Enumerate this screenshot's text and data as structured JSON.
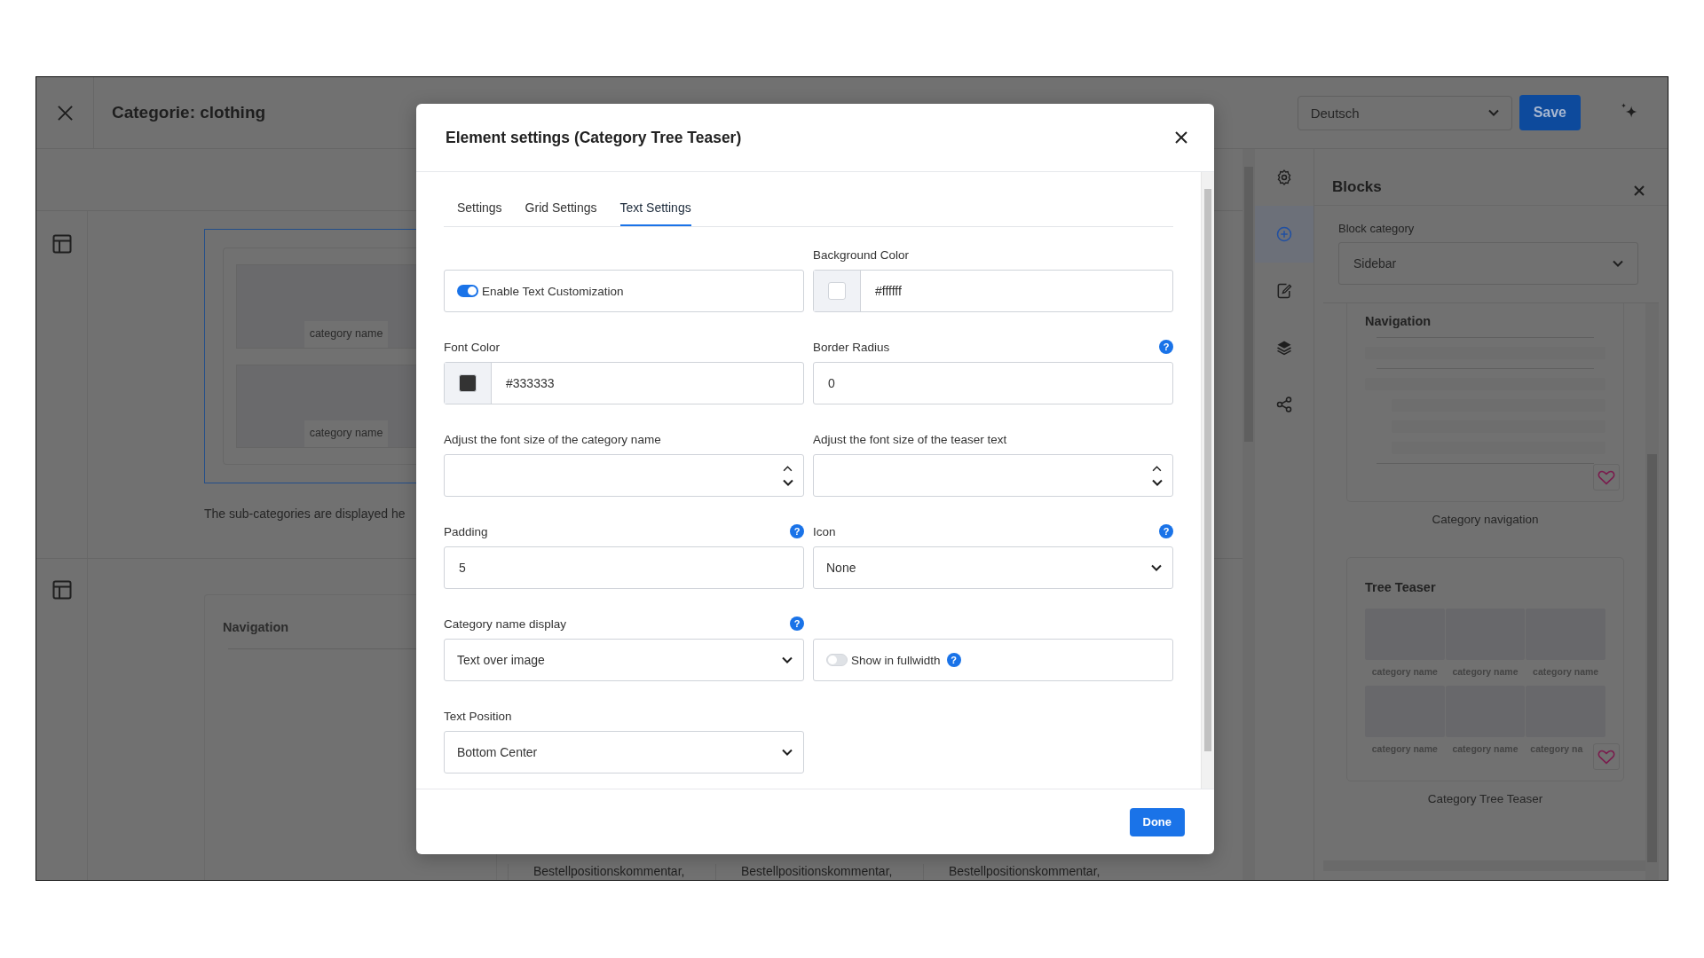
{
  "app": {
    "title": "Categorie: clothing",
    "language": "Deutsch",
    "save": "Save"
  },
  "canvas": {
    "teaser_labels": [
      "category name",
      "category name"
    ],
    "description": "The sub-categories are displayed he",
    "nav_heading": "Navigation",
    "comments": [
      "Bestellpositionskommentar,",
      "Bestellpositionskommentar,",
      "Bestellpositionskommentar,"
    ]
  },
  "rail": [
    {
      "kind": "gear",
      "selected": false
    },
    {
      "kind": "plus",
      "selected": true
    },
    {
      "kind": "edit",
      "selected": false
    },
    {
      "kind": "layers",
      "selected": false
    },
    {
      "kind": "share",
      "selected": false
    }
  ],
  "blocks": {
    "title": "Blocks",
    "category_label": "Block category",
    "category": "Sidebar",
    "cards": [
      {
        "kind": "navigation",
        "heading": "Navigation",
        "caption": "Category navigation"
      },
      {
        "kind": "tree_teaser",
        "heading": "Tree Teaser",
        "labels": [
          "category name",
          "category name",
          "category name",
          "category name",
          "category name",
          "category na"
        ],
        "caption": "Category Tree Teaser"
      }
    ]
  },
  "modal": {
    "title": "Element settings (Category Tree Teaser)",
    "tabs": [
      {
        "label": "Settings",
        "selected": false
      },
      {
        "label": "Grid Settings",
        "selected": false
      },
      {
        "label": "Text Settings",
        "selected": true
      }
    ],
    "fields": [
      {
        "kind": "toggle",
        "text": "Enable Text Customization",
        "on": true
      },
      {
        "kind": "color",
        "label": "Background Color",
        "value": "#ffffff",
        "color": "#ffffff"
      },
      {
        "kind": "color",
        "label": "Font Color",
        "value": "#333333",
        "color": "#333333"
      },
      {
        "kind": "text",
        "label": "Border Radius",
        "help": "?",
        "value": "0"
      },
      {
        "kind": "spinner",
        "label": "Adjust the font size of the category name"
      },
      {
        "kind": "spinner",
        "label": "Adjust the font size of the teaser text"
      },
      {
        "kind": "text",
        "label": "Padding",
        "help": "?",
        "value": "5"
      },
      {
        "kind": "select",
        "label": "Icon",
        "help": "?",
        "value": "None"
      },
      {
        "kind": "select",
        "label": "Category name display",
        "help": "?",
        "value": "Text over image"
      },
      {
        "kind": "toggle",
        "text": "Show in fullwidth",
        "on": false,
        "help": "?"
      },
      {
        "kind": "select",
        "label": "Text Position",
        "value": "Bottom Center"
      }
    ],
    "done": "Done"
  }
}
